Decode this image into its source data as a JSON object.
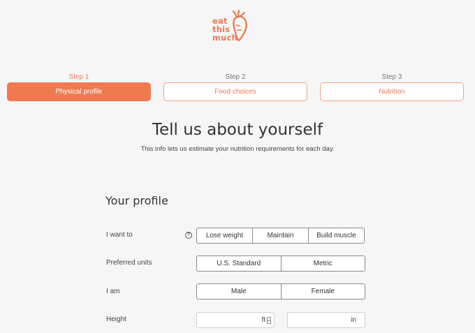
{
  "logo": {
    "line1": "eat",
    "line2": "this",
    "line3": "much",
    "icon": "carrot-icon"
  },
  "steps": [
    {
      "number": "Step 1",
      "label": "Physical profile",
      "active": true
    },
    {
      "number": "Step 2",
      "label": "Food choices",
      "active": false
    },
    {
      "number": "Step 3",
      "label": "Nutrition",
      "active": false
    }
  ],
  "heading": {
    "title": "Tell us about yourself",
    "subtitle": "This info lets us estimate your nutrition requirements for each day."
  },
  "profile": {
    "section_title": "Your profile",
    "goal": {
      "label": "I want to",
      "help_icon": "question-circle-icon",
      "options": [
        "Lose weight",
        "Maintain",
        "Build muscle"
      ]
    },
    "units": {
      "label": "Preferred units",
      "options": [
        "U.S. Standard",
        "Metric"
      ]
    },
    "sex": {
      "label": "I am",
      "options": [
        "Male",
        "Female"
      ]
    },
    "height": {
      "label": "Height",
      "feet_unit": "ft",
      "inches_unit": "in",
      "feet_value": "",
      "inches_value": ""
    }
  },
  "colors": {
    "accent": "#ef7a50",
    "background": "#f6f6f6"
  }
}
